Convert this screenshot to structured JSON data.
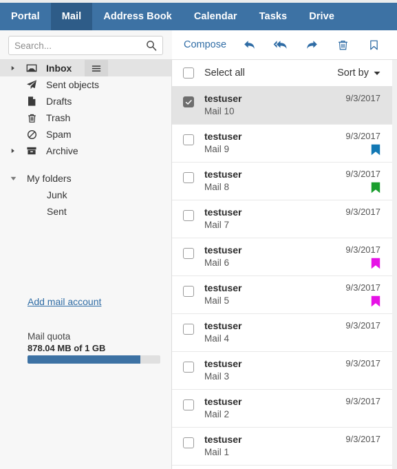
{
  "topnav": {
    "items": [
      {
        "label": "Portal",
        "active": false
      },
      {
        "label": "Mail",
        "active": true
      },
      {
        "label": "Address Book",
        "active": false
      },
      {
        "label": "Calendar",
        "active": false
      },
      {
        "label": "Tasks",
        "active": false
      },
      {
        "label": "Drive",
        "active": false
      }
    ],
    "active_color": "#2e5c88",
    "bar_color": "#3d72a4"
  },
  "search": {
    "placeholder": "Search...",
    "value": "",
    "icon": "search-icon"
  },
  "toolbar": {
    "compose_label": "Compose",
    "actions": [
      {
        "name": "reply-icon",
        "title": "Reply"
      },
      {
        "name": "reply-all-icon",
        "title": "Reply all"
      },
      {
        "name": "forward-icon",
        "title": "Forward"
      },
      {
        "name": "trash-icon",
        "title": "Delete"
      },
      {
        "name": "bookmark-icon",
        "title": "Flag"
      }
    ],
    "icon_color": "#2f6ca5"
  },
  "sidebar": {
    "folders": [
      {
        "label": "Inbox",
        "icon": "inbox-icon",
        "twisty": "right",
        "selected": true,
        "bold": true,
        "menu": true
      },
      {
        "label": "Sent objects",
        "icon": "paper-plane-icon",
        "twisty": "",
        "selected": false,
        "bold": false,
        "menu": false
      },
      {
        "label": "Drafts",
        "icon": "document-icon",
        "twisty": "",
        "selected": false,
        "bold": false,
        "menu": false
      },
      {
        "label": "Trash",
        "icon": "trash-icon",
        "twisty": "",
        "selected": false,
        "bold": false,
        "menu": false
      },
      {
        "label": "Spam",
        "icon": "ban-icon",
        "twisty": "",
        "selected": false,
        "bold": false,
        "menu": false
      },
      {
        "label": "Archive",
        "icon": "archive-icon",
        "twisty": "right",
        "selected": false,
        "bold": false,
        "menu": false
      }
    ],
    "group": {
      "label": "My folders",
      "twisty": "down",
      "children": [
        {
          "label": "Junk"
        },
        {
          "label": "Sent"
        }
      ]
    },
    "add_account_link": "Add mail account",
    "quota": {
      "title": "Mail quota",
      "value": "878.04 MB of 1 GB",
      "percent": 85,
      "fill_color": "#3d72a4",
      "track_color": "#e0e0e0"
    }
  },
  "maillist": {
    "select_all_label": "Select all",
    "select_all_checked": false,
    "sort_by_label": "Sort by",
    "rows": [
      {
        "from": "testuser",
        "subject": "Mail 10",
        "date": "9/3/2017",
        "checked": true,
        "selected": true,
        "flag": ""
      },
      {
        "from": "testuser",
        "subject": "Mail 9",
        "date": "9/3/2017",
        "checked": false,
        "selected": false,
        "flag": "#1278b4"
      },
      {
        "from": "testuser",
        "subject": "Mail 8",
        "date": "9/3/2017",
        "checked": false,
        "selected": false,
        "flag": "#1a9e2e"
      },
      {
        "from": "testuser",
        "subject": "Mail 7",
        "date": "9/3/2017",
        "checked": false,
        "selected": false,
        "flag": ""
      },
      {
        "from": "testuser",
        "subject": "Mail 6",
        "date": "9/3/2017",
        "checked": false,
        "selected": false,
        "flag": "#e612e6"
      },
      {
        "from": "testuser",
        "subject": "Mail 5",
        "date": "9/3/2017",
        "checked": false,
        "selected": false,
        "flag": "#e612e6"
      },
      {
        "from": "testuser",
        "subject": "Mail 4",
        "date": "9/3/2017",
        "checked": false,
        "selected": false,
        "flag": ""
      },
      {
        "from": "testuser",
        "subject": "Mail 3",
        "date": "9/3/2017",
        "checked": false,
        "selected": false,
        "flag": ""
      },
      {
        "from": "testuser",
        "subject": "Mail 2",
        "date": "9/3/2017",
        "checked": false,
        "selected": false,
        "flag": ""
      },
      {
        "from": "testuser",
        "subject": "Mail 1",
        "date": "9/3/2017",
        "checked": false,
        "selected": false,
        "flag": ""
      }
    ]
  }
}
